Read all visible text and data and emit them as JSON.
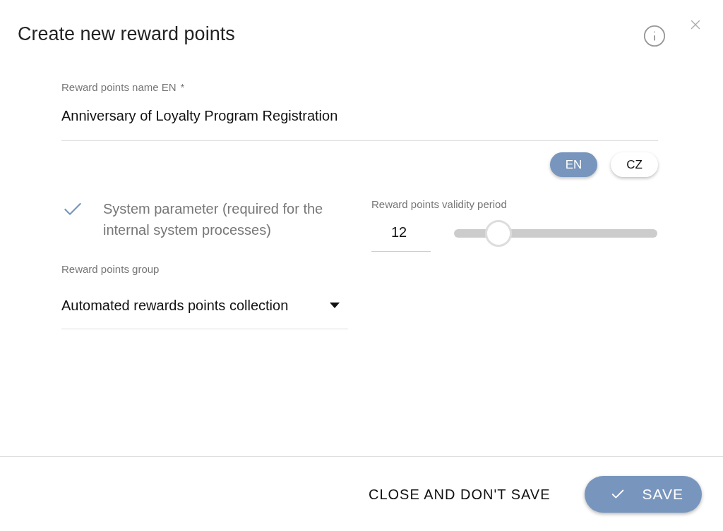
{
  "dialog": {
    "title": "Create new reward points"
  },
  "name_field": {
    "label": "Reward points name EN",
    "required_mark": "*",
    "value": "Anniversary of Loyalty Program Registration"
  },
  "languages": [
    {
      "label": "EN",
      "selected": true
    },
    {
      "label": "CZ",
      "selected": false
    }
  ],
  "system_parameter": {
    "label": "System parameter (required for the internal system processes)",
    "checked": true
  },
  "validity_period": {
    "label": "Reward points validity period",
    "value": "12",
    "level": 0.22
  },
  "group_field": {
    "label": "Reward points group",
    "value": "Automated rewards points collection"
  },
  "footer": {
    "cancel": "CLOSE AND DON'T SAVE",
    "save": "SAVE"
  }
}
